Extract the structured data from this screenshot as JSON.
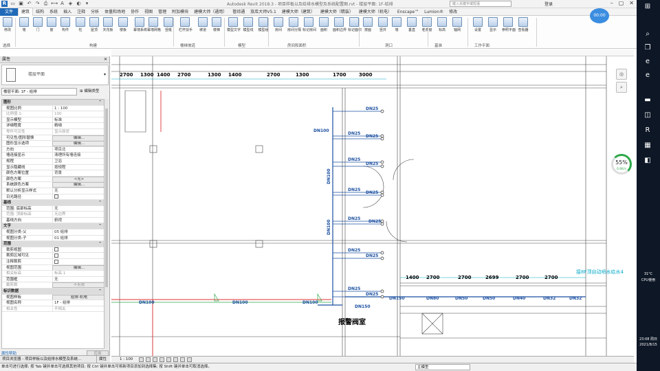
{
  "titlebar": {
    "title": "Autodesk Revit 2018.3 -     项目样板以及给排水模型及系统配置图.rvt - 楼层平面: 1F-给排",
    "search_placeholder": "键入关键字或短语",
    "login": "登录"
  },
  "tabs": [
    "文件",
    "建筑",
    "结构",
    "系统",
    "插入",
    "注释",
    "分析",
    "体量和场地",
    "协作",
    "视图",
    "管理",
    "附加模块",
    "建模大师（通用）",
    "管综通",
    "族库大师V5.1",
    "建模大师（建筑）",
    "建模大师（精装）",
    "建模大师（机电）",
    "Enscape™",
    "Lumion®",
    "修改"
  ],
  "active_tab": "建筑",
  "ribbon": {
    "buttons": [
      "修改",
      "墙",
      "门",
      "窗",
      "构件",
      "柱",
      "屋顶",
      "天花板",
      "楼板",
      "幕墙系统",
      "幕墙网格",
      "竖梃",
      "栏杆扶手",
      "坡道",
      "楼梯",
      "模型文字",
      "模型线",
      "模型组",
      "房间",
      "房间分隔",
      "标记房间",
      "面积",
      "面积边界",
      "标记面积",
      "按面",
      "竖井",
      "墙",
      "垂直",
      "老虎窗",
      "标高",
      "轴网",
      "设置",
      "显示",
      "参照平面",
      "查看器"
    ],
    "panels": [
      "选择",
      "构建",
      "楼梯坡道",
      "模型",
      "房间和面积",
      "洞口",
      "基准",
      "工作平面"
    ]
  },
  "properties": {
    "title": "属性",
    "type_name": "楼层平面",
    "view_selector": "楼层平面: 1F - 给排",
    "edit_type": "编辑类型",
    "rows": [
      {
        "g": "图形"
      },
      {
        "k": "视图比例",
        "v": "1 : 100"
      },
      {
        "k": "比例值 1:",
        "v": "100",
        "dim": true
      },
      {
        "k": "显示模型",
        "v": "标准"
      },
      {
        "k": "详细程度",
        "v": "精细"
      },
      {
        "k": "零件可见性",
        "v": "显示原状",
        "dim": true
      },
      {
        "k": "可见性/图形替换",
        "v": "编辑...",
        "btn": true
      },
      {
        "k": "图形显示选项",
        "v": "编辑...",
        "btn": true
      },
      {
        "k": "方向",
        "v": "项目北"
      },
      {
        "k": "墙连接显示",
        "v": "清理所有墙连接"
      },
      {
        "k": "规程",
        "v": "卫浴"
      },
      {
        "k": "显示隐藏线",
        "v": "按规程"
      },
      {
        "k": "颜色方案位置",
        "v": "背景"
      },
      {
        "k": "颜色方案",
        "v": "<无>",
        "btn": true
      },
      {
        "k": "系统颜色方案",
        "v": "编辑...",
        "btn": true
      },
      {
        "k": "默认分析显示样式",
        "v": "无"
      },
      {
        "k": "日光路径",
        "v": "",
        "chk": true
      },
      {
        "g": "基线"
      },
      {
        "k": "范围: 底部标高",
        "v": "无"
      },
      {
        "k": "范围: 顶部标高",
        "v": "无边界",
        "dim": true
      },
      {
        "k": "基线方向",
        "v": "俯视"
      },
      {
        "g": "文字"
      },
      {
        "k": "视图分类-父",
        "v": "05 给排"
      },
      {
        "k": "视图分类-子",
        "v": "01 给排"
      },
      {
        "g": "范围"
      },
      {
        "k": "裁剪视图",
        "v": "",
        "chk": true
      },
      {
        "k": "裁剪区域可见",
        "v": "",
        "chk": true
      },
      {
        "k": "注释裁剪",
        "v": "",
        "chk": true
      },
      {
        "k": "视图范围",
        "v": "编辑...",
        "btn": true
      },
      {
        "k": "相关标高",
        "v": "标高 1",
        "dim": true
      },
      {
        "k": "范围框",
        "v": "无"
      },
      {
        "k": "截剪裁",
        "v": "不剪裁",
        "btn": true,
        "dim": true
      },
      {
        "g": "标识数据"
      },
      {
        "k": "视图样板",
        "v": "给排-机电",
        "btn": true
      },
      {
        "k": "视图名称",
        "v": "1F - 给排"
      },
      {
        "k": "相关性",
        "v": "不相关",
        "dim": true
      }
    ],
    "help": "属性帮助",
    "apply": "应用"
  },
  "project_browser": {
    "label": "项目浏览器 - 项目样板以及给排水模型及系统...",
    "tab": "属性"
  },
  "viewbar": {
    "scale": "1 : 100"
  },
  "statusbar": {
    "message": "单击可进行选择; 按 Tab 键并单击可选择其他项目; 按 Ctrl 键并单击可将新项目添加到选择集; 按 Shift 键并单击可取消选择。",
    "model": "主模型"
  },
  "progress": {
    "pct": "55",
    "rate": "0.6K/s"
  },
  "avatar": "00:00",
  "clock": {
    "temp": "31°C",
    "weather": "CPU使用",
    "time": "23:08 周日",
    "date": "2021/8/15"
  },
  "drawing": {
    "top_dims": [
      "2700",
      "1300",
      "1400",
      "2700",
      "1300",
      "1400",
      "2700",
      "1300",
      "1700",
      "3000"
    ],
    "bottom_dims": [
      "1400",
      "2700",
      "2700",
      "2699",
      "2700",
      "2700"
    ],
    "dn25_labels": [
      "DN25",
      "DN25",
      "DN25",
      "DN25",
      "DN25",
      "DN25",
      "DN25",
      "DN25",
      "DN25",
      "DN25",
      "DN25",
      "DN25",
      "DN25"
    ],
    "pipe_labels": [
      "DN100",
      "DN100",
      "DN100",
      "DN100",
      "DN100",
      "DN100",
      "DN150",
      "DN80",
      "DN50",
      "DN50",
      "DN40",
      "DN32",
      "DN32",
      "DN150"
    ],
    "room_label": "报警阀室",
    "note": "接8F顶自动喷水给水4"
  },
  "colors": {
    "accent": "#1f6ab8",
    "cyan": "#00a8c8",
    "red": "#e03030",
    "green": "#2ea84a",
    "dim_text": "#000000"
  }
}
